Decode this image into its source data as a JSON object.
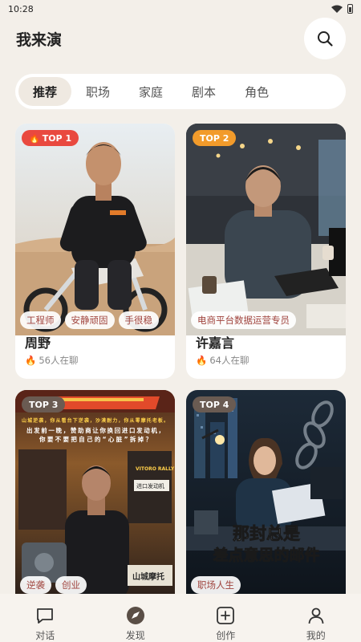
{
  "status": {
    "time": "10:28"
  },
  "header": {
    "title": "我来演",
    "search_icon": "search-icon"
  },
  "tabs": [
    {
      "label": "推荐",
      "active": true
    },
    {
      "label": "职场",
      "active": false
    },
    {
      "label": "家庭",
      "active": false
    },
    {
      "label": "剧本",
      "active": false
    },
    {
      "label": "角色",
      "active": false
    }
  ],
  "cards": [
    {
      "rank": "TOP 1",
      "badge_color": "#e9493f",
      "fire": true,
      "tags": [
        "工程师",
        "安静顽固",
        "手很稳"
      ],
      "name": "周野",
      "meta": "56人在聊"
    },
    {
      "rank": "TOP 2",
      "badge_color": "#f29b2b",
      "fire": false,
      "tags": [
        "电商平台数据运营专员"
      ],
      "name": "许嘉言",
      "meta": "64人在聊"
    },
    {
      "rank": "TOP 3",
      "badge_color": "#6a5b52",
      "tags": [
        "逆袭",
        "创业"
      ],
      "poster": {
        "headline": "山城逆袭，你从看台下逆袭，沙漠耐力，你从零摩托老板。",
        "lines": [
          "出发前一晚，赞助商让你换回进口发动机，",
          "你要不要把自己的“心脏”拆掉？"
        ],
        "shop": "山城摩托",
        "bill": "VITORO RALLY",
        "import": "进口发动机"
      }
    },
    {
      "rank": "TOP 4",
      "badge_color": "#6a5b52",
      "tags": [
        "职场人生"
      ],
      "poster": {
        "title_line1": "那封总是",
        "title_line2": "差点意思的邮件"
      }
    }
  ],
  "bottom_nav": [
    {
      "label": "对话",
      "icon": "chat-bubble-icon"
    },
    {
      "label": "发现",
      "icon": "compass-icon"
    },
    {
      "label": "创作",
      "icon": "plus-square-icon"
    },
    {
      "label": "我的",
      "icon": "person-icon"
    }
  ],
  "colors": {
    "background": "#f3efe9",
    "tag_text": "#a0443e",
    "top1": "#e9493f",
    "top2": "#f29b2b"
  }
}
